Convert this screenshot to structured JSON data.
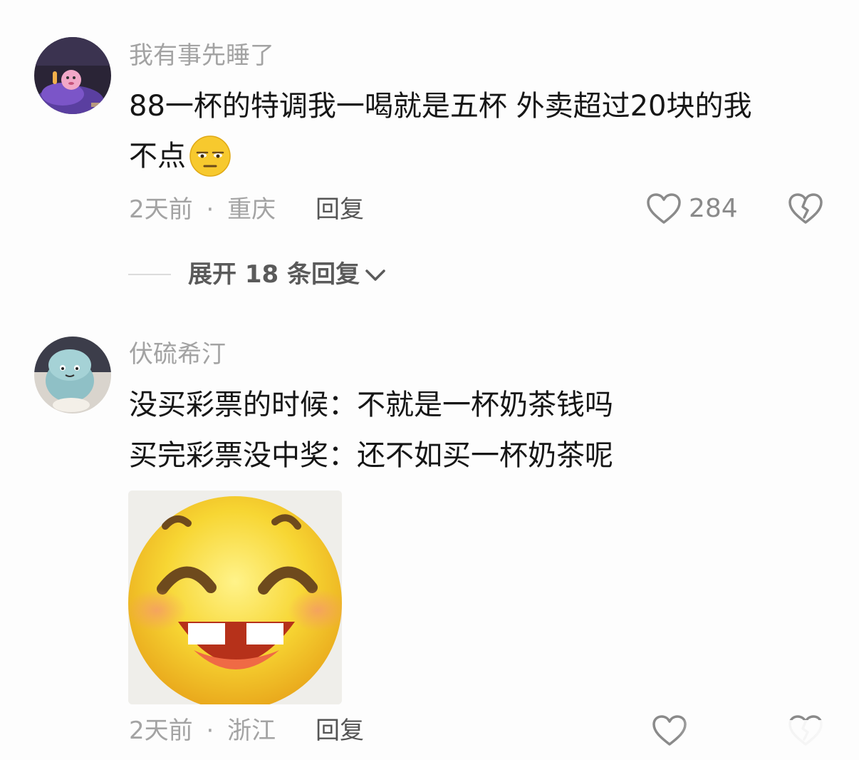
{
  "comments": [
    {
      "username": "我有事先睡了",
      "text_lines": [
        "88一杯的特调我一喝就是五杯 外卖超过20块的我",
        "不点"
      ],
      "time": "2天前",
      "separator": "·",
      "location": "重庆",
      "reply_label": "回复",
      "like_count": "284"
    },
    {
      "username": "伏硫希汀",
      "text_lines": [
        "没买彩票的时候：不就是一杯奶茶钱吗",
        "买完彩票没中奖：还不如买一杯奶茶呢"
      ],
      "time": "2天前",
      "separator": "·",
      "location": "浙江",
      "reply_label": "回复",
      "like_count": ""
    }
  ],
  "expand_replies": {
    "label": "展开 18 条回复"
  },
  "icons": {
    "heart": "heart-outline-icon",
    "dislike": "broken-heart-icon",
    "chevron": "chevron-down-icon",
    "emoji_inline": "unamused-face-emoji",
    "meme": "grinning-face-meme"
  },
  "colors": {
    "text_primary": "#161616",
    "text_secondary": "#a3a3a3",
    "text_action": "#555555",
    "emoji_yellow": "#f4c430"
  }
}
